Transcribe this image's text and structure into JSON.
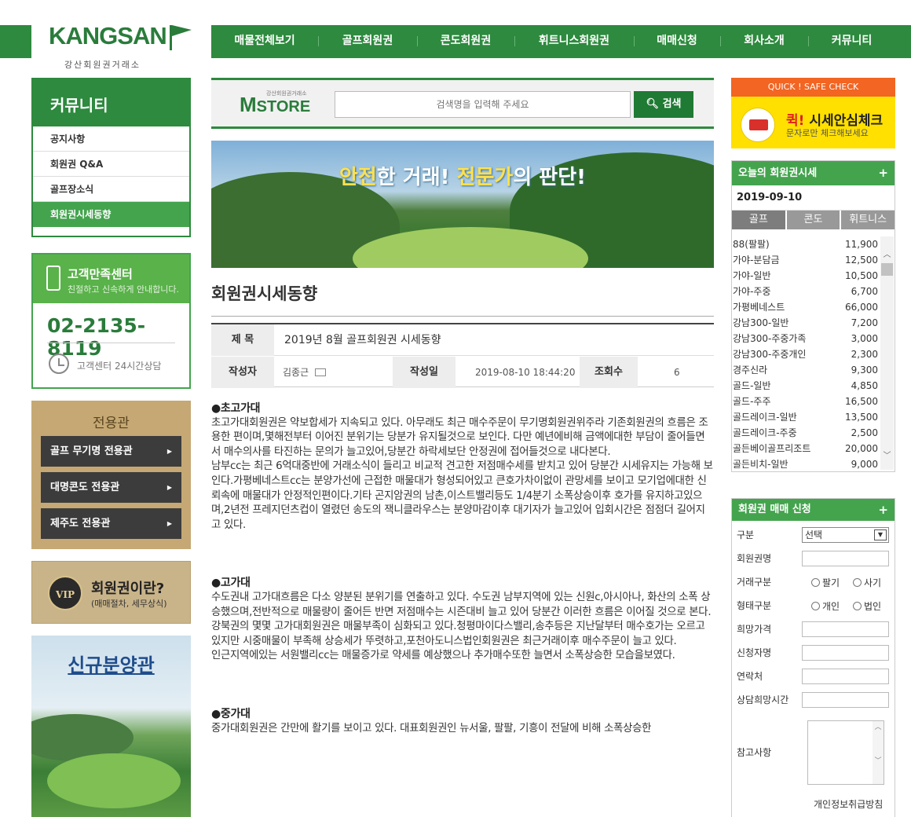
{
  "header": {
    "logo_text": "KANGSAN",
    "logo_sub": "강산회원권거래소",
    "nav": [
      "매물전체보기",
      "골프회원권",
      "콘도회원권",
      "휘트니스회원권",
      "매매신청",
      "회사소개",
      "커뮤니티"
    ],
    "brand_color": "#2d8a3e"
  },
  "sidebar": {
    "title": "커뮤니티",
    "items": [
      "공지사항",
      "회원권 Q&A",
      "골프장소식",
      "회원권시세동향"
    ],
    "active_index": 3,
    "customer": {
      "title": "고객만족센터",
      "subtitle": "친절하고 신속하게 안내합니다.",
      "phone": "02-2135-8119",
      "hours": "고객센터 24시간상담"
    },
    "dedicated": {
      "title": "전용관",
      "items": [
        "골프 무기명 전용관",
        "대명콘도 전용관",
        "제주도 전용관"
      ]
    },
    "vip": {
      "badge": "VIP",
      "title": "회원권이란?",
      "subtitle": "(매매절차, 세무상식)"
    },
    "new_sale": "신규분양관"
  },
  "search": {
    "logo": "STORE",
    "logo_small": "강산회원권거래소",
    "placeholder": "검색명을 입력해 주세요",
    "button": "검색"
  },
  "banner": {
    "pre1": "안전",
    "mid1": "한 거래! ",
    "pre2": "전문가",
    "mid2": "의 판단!"
  },
  "page_title": "회원권시세동향",
  "post": {
    "title_label": "제 목",
    "title": "2019년 8월 골프회원권 시세동향",
    "author_label": "작성자",
    "author": "김종근",
    "date_label": "작성일",
    "date": "2019-08-10 18:44:20",
    "views_label": "조회수",
    "views": "6"
  },
  "article": [
    {
      "h": "●초고가대",
      "p": "초고가대회원권은 약보합세가 지속되고 있다. 아무래도 최근 매수주문이 무기명회원권위주라 기존회원권의 흐름은 조용한 편이며,몇해전부터 이어진 분위기는 당분가 유지될것으로 보인다. 다만 예년에비해 금액에대한 부담이 줄어들면서 매수의사를 타진하는 문의가 늘고있어,당분간 하락세보단 안정권에 접어들것으로 내다본다.",
      "p2": "남부cc는 최근 6억대중반에 거래소식이 들리고 비교적 견고한 저점매수세를 받치고 있어 당분간 시세유지는 가능해 보인다.가평베네스트cc는 분양가선에 근접한 매물대가 형성되어있고 큰호가차이없이 관망세를 보이고 모기업에대한 신뢰속에 매물대가 안정적인편이다.기타 곤지암권의 남촌,이스트밸리등도 1/4분기 소폭상승이후 호가를 유지하고있으며,2년전 프레지던츠컵이 열렸던 송도의 잭니클라우스는 분양마감이후 대기자가 늘고있어 입회시간은 점점더 길어지고 있다."
    },
    {
      "h": "●고가대",
      "p": "수도권내 고가대흐름은 다소 양분된 분위기를 연출하고 있다. 수도권 남부지역에 있는 신원c,아시아나, 화산의 소폭 상승했으며,전반적으로 매물량이 줄어든 반면 저점매수는 시즌대비 늘고 있어 당분간 이러한 흐름은 이어질 것으로 본다.",
      "p2": "강북권의 몇몇 고가대회원권은 매물부족이 심화되고 있다.청평마이다스밸리,송추등은 지난달부터 매수호가는 오르고있지만 시중매물이 부족해 상승세가 뚜렷하고,포천아도니스법인회원권은 최근거래이후 매수주문이 늘고 있다.",
      "p3": "인근지역에있는 서원밸리cc는 매물증가로 약세를 예상했으나 추가매수또한 늘면서 소폭상승한 모습을보였다."
    },
    {
      "h": "●중가대",
      "p": "중가대회원권은 간만에 활기를 보이고 있다. 대표회원권인 뉴서울, 팔팔, 기흥이 전달에 비해 소폭상승한"
    }
  ],
  "quick": {
    "header": "QUICK ! SAFE CHECK",
    "title_red": "퀵!",
    "title": " 시세안심체크",
    "sub": "문자로만 체크해보세요"
  },
  "today": {
    "title": "오늘의 회원권시세",
    "date": "2019-09-10",
    "tabs": [
      "골프",
      "콘도",
      "휘트니스"
    ],
    "rows": [
      {
        "name": "88(팔팔)",
        "price": "11,900"
      },
      {
        "name": "가야-분담금",
        "price": "12,500"
      },
      {
        "name": "가야-일반",
        "price": "10,500"
      },
      {
        "name": "가야-주중",
        "price": "6,700"
      },
      {
        "name": "가평베네스트",
        "price": "66,000"
      },
      {
        "name": "강남300-일반",
        "price": "7,200"
      },
      {
        "name": "강남300-주중가족",
        "price": "3,000"
      },
      {
        "name": "강남300-주중개인",
        "price": "2,300"
      },
      {
        "name": "경주신라",
        "price": "9,300"
      },
      {
        "name": "골드-일반",
        "price": "4,850"
      },
      {
        "name": "골드-주주",
        "price": "16,500"
      },
      {
        "name": "골드레이크-일반",
        "price": "13,500"
      },
      {
        "name": "골드레이크-주중",
        "price": "2,500"
      },
      {
        "name": "골든베이골프리조트",
        "price": "20,000"
      },
      {
        "name": "골든비치-일반",
        "price": "9,000"
      }
    ]
  },
  "trade_form": {
    "title": "회원권 매매 신청",
    "type_label": "구분",
    "type_value": "선택",
    "name_label": "회원권명",
    "trade_label": "거래구분",
    "trade_opts": [
      "팔기",
      "사기"
    ],
    "form_label": "형태구분",
    "form_opts": [
      "개인",
      "법인"
    ],
    "price_label": "희망가격",
    "applicant_label": "신청자명",
    "contact_label": "연락처",
    "time_label": "상담희망시간",
    "note_label": "참고사항",
    "privacy": "개인정보취급방침"
  }
}
